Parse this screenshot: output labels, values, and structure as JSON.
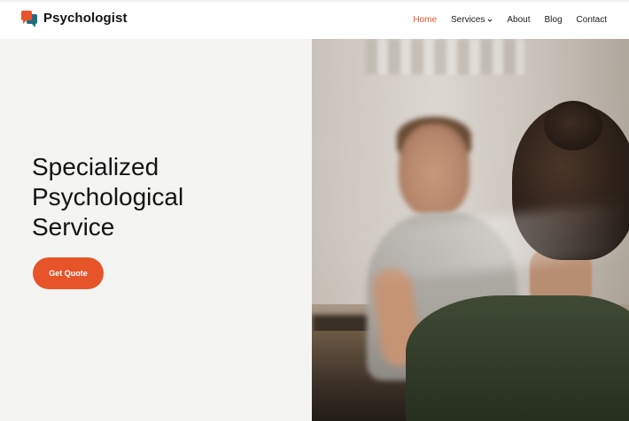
{
  "brand": {
    "name": "Psychologist",
    "logo_icon": "speech-bubbles-icon",
    "colors": {
      "primary": "#e8542a",
      "secondary": "#1f6d80"
    }
  },
  "nav": {
    "items": [
      {
        "label": "Home",
        "active": true
      },
      {
        "label": "Services",
        "has_dropdown": true
      },
      {
        "label": "About"
      },
      {
        "label": "Blog"
      },
      {
        "label": "Contact"
      }
    ]
  },
  "hero": {
    "title_lines": [
      "Specialized",
      "Psychological",
      "Service"
    ],
    "cta_label": "Get Quote",
    "background": "#f4f4f2"
  }
}
